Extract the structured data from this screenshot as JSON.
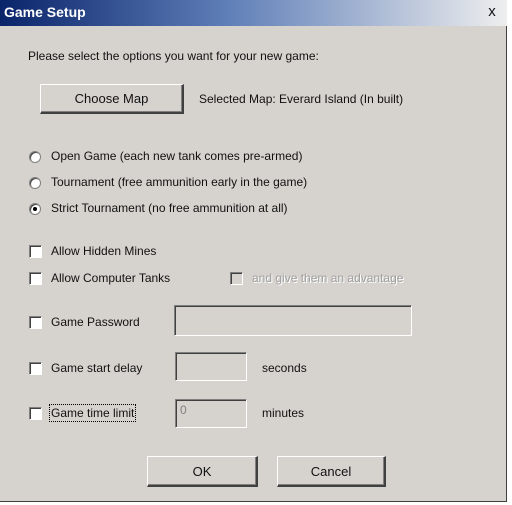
{
  "window": {
    "title": "Game Setup",
    "close_glyph": "x"
  },
  "prompt": "Please select the options you want for your new game:",
  "map": {
    "button_label": "Choose Map",
    "selected_text": "Selected Map: Everard Island (In built)"
  },
  "game_types": [
    {
      "label": "Open Game (each new tank comes pre-armed)",
      "selected": false
    },
    {
      "label": "Tournament (free ammunition early in the game)",
      "selected": false
    },
    {
      "label": "Strict Tournament (no free ammunition at all)",
      "selected": true
    }
  ],
  "options": {
    "hidden_mines": "Allow Hidden Mines",
    "computer_tanks": "Allow Computer Tanks",
    "advantage": "and give them an advantage",
    "password": "Game Password",
    "start_delay": "Game start delay",
    "start_delay_unit": "seconds",
    "time_limit": "Game time limit",
    "time_limit_value": "0",
    "time_limit_unit": "minutes"
  },
  "buttons": {
    "ok": "OK",
    "cancel": "Cancel"
  }
}
